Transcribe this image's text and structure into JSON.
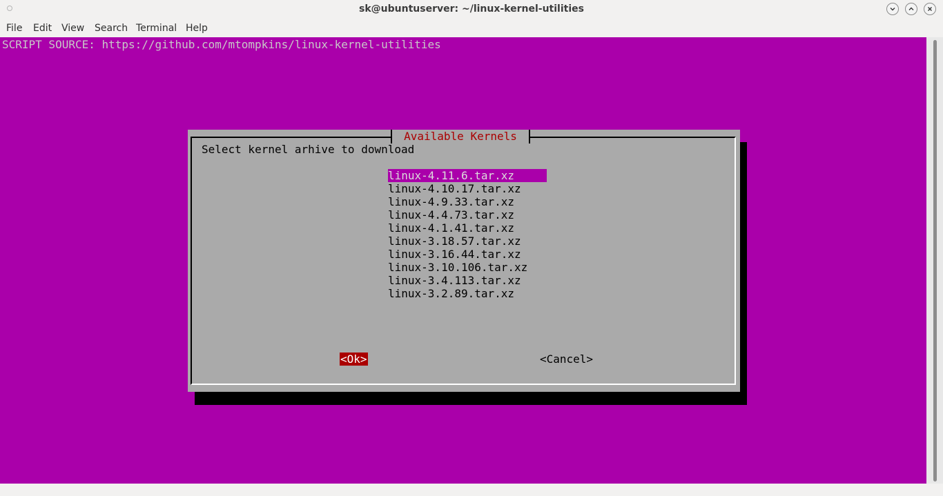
{
  "window": {
    "title": "sk@ubuntuserver: ~/linux-kernel-utilities"
  },
  "menu": [
    "File",
    "Edit",
    "View",
    "Search",
    "Terminal",
    "Help"
  ],
  "terminal": {
    "source_line": "SCRIPT SOURCE: https://github.com/mtompkins/linux-kernel-utilities"
  },
  "dialog": {
    "title": "Available Kernels",
    "prompt": "Select kernel arhive to download",
    "kernels": [
      "linux-4.11.6.tar.xz",
      "linux-4.10.17.tar.xz",
      "linux-4.9.33.tar.xz",
      "linux-4.4.73.tar.xz",
      "linux-4.1.41.tar.xz",
      "linux-3.18.57.tar.xz",
      "linux-3.16.44.tar.xz",
      "linux-3.10.106.tar.xz",
      "linux-3.4.113.tar.xz",
      "linux-3.2.89.tar.xz"
    ],
    "selected_index": 0,
    "ok_label": "<Ok>",
    "cancel_label": "<Cancel>"
  },
  "colors": {
    "terminal_bg": "#aa00aa",
    "dialog_bg": "#aaaaaa",
    "title_text": "#aa0000",
    "selection_bg": "#aa00aa",
    "ok_bg": "#aa0000"
  },
  "icons": {
    "window_controls": [
      "minimize-icon",
      "maximize-icon",
      "close-icon"
    ]
  }
}
